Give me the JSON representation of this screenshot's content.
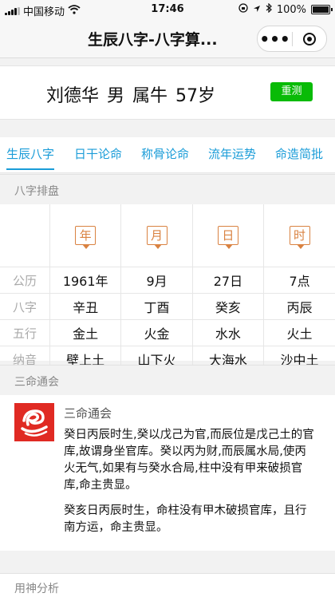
{
  "status": {
    "carrier": "中国移动",
    "time": "17:46",
    "battery": "100%"
  },
  "nav": {
    "title": "生辰八字-八字算..."
  },
  "profile": {
    "name": "刘德华",
    "gender": "男",
    "zodiac": "属牛",
    "age": "57岁",
    "retest_label": "重测"
  },
  "tabs": [
    "生辰八字",
    "日干论命",
    "称骨论命",
    "流年运势",
    "命造简批"
  ],
  "bazi": {
    "title": "八字排盘",
    "headers": [
      "年",
      "月",
      "日",
      "时"
    ],
    "rows": [
      {
        "label": "公历",
        "cells": [
          "1961年",
          "9月",
          "27日",
          "7点"
        ]
      },
      {
        "label": "八字",
        "cells": [
          "辛丑",
          "丁酉",
          "癸亥",
          "丙辰"
        ]
      },
      {
        "label": "五行",
        "cells": [
          "金土",
          "火金",
          "水水",
          "火土"
        ]
      },
      {
        "label": "纳音",
        "cells": [
          "壁上土",
          "山下火",
          "大海水",
          "沙中土"
        ]
      }
    ]
  },
  "sanming": {
    "title": "三命通会",
    "source": "三命通会",
    "para1": "癸日丙辰时生,癸以戊己为官,而辰位是戊己土的官库,故谓身坐官库。癸以丙为财,而辰属水局,使丙火无气,如果有与癸水合局,柱中没有甲来破损官库,命主贵显。",
    "para2": "癸亥日丙辰时生，命柱没有甲木破损官库，且行南方运，命主贵显。"
  },
  "next_section": {
    "title": "用神分析"
  }
}
